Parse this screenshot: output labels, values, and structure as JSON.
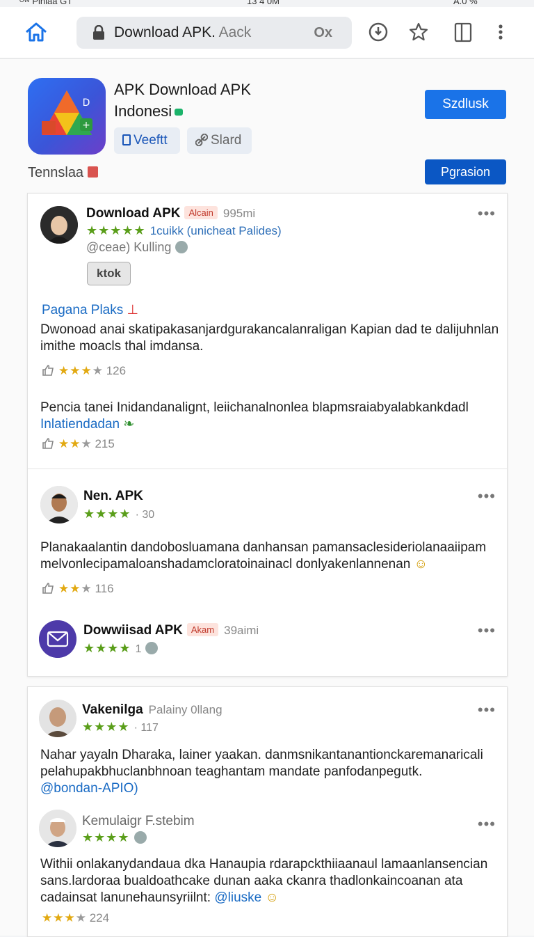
{
  "status_bar": {
    "left": "ᴼᵂ Pinlaa GT",
    "center": "13 4 0M",
    "right": "A.0 %"
  },
  "browser": {
    "url_main": "Download APK.",
    "url_dim": " Aack",
    "url_suffix": "Ox"
  },
  "app": {
    "title_line1": "APK Download APK",
    "title_line2": "Indonesi",
    "verify_chip": "Veeftt",
    "share_chip": "Slard",
    "primary_button": "Szdlusk",
    "secondary_button": "Pgrasion",
    "section_label": "Tennslaa"
  },
  "reviews": [
    {
      "name": "Download APK",
      "tag": "Alcain",
      "meta": "995mi",
      "stars_text": "★★★★★",
      "stars_label": "1cuikk (unicheat Palides)",
      "handle": "@ceae) Kulling",
      "button": "ktok",
      "link": "Pagana Plaks",
      "text": "Dwonoad anai skatipakasanjardgurakancalanraligan Kapian dad te dalijuhnlan imithe moacls thal imdansa.",
      "rating_stars": "★★★",
      "rating_empty": "★",
      "rating_count": "126",
      "text2": "Pencia tanei Inidandanalignt, leiichanalnonlea blapmsraiabyalabkankdadl",
      "text2_link": "Inlatiendadan",
      "rating2_stars": "★★",
      "rating2_empty": "★",
      "rating2_count": "215"
    },
    {
      "name": "Nen. APK",
      "stars_text": "★★★★",
      "stars_count": "· 30",
      "text": "Planakaalantin dandobosluamana danhansan pamansaclesideriolanaaiipam melvonlecipamaloanshadamcloratoinainacl donlyakenlannenan",
      "rating_stars": "★★",
      "rating_empty": "★",
      "rating_count": "116"
    },
    {
      "name": "Dowwiisad APK",
      "tag": "Akam",
      "meta": "39aimi",
      "stars_text": "★★★★",
      "stars_count": "1"
    },
    {
      "name": "Vakenilga",
      "meta": "Palainy 0llang",
      "stars_text": "★★★★",
      "stars_count": "· 117",
      "text": "Nahar yayaln Dharaka, lainer yaakan. danmsnikantanantionckaremanaricali pelahupakbhuclanbhnoan teaghantam mandate panfodanpegutk.",
      "text_link": "@bondan-APIO)"
    },
    {
      "name": "Kemulaigr F.stebim",
      "stars_text": "★★★★",
      "text": "Withii onlakanydandaua dka Hanaupia rdarapckthiiaanaul lamaanlansencian sans.lardoraa bualdoathcake dunan aaka ckanra thadlonkaincoanan ata cadainsat lanunehaunsyriilnt:",
      "text_link": "@liuske",
      "rating_stars": "★★★",
      "rating_empty": "★",
      "rating_count": "224"
    }
  ],
  "colors": {
    "accent": "#1a73e8",
    "star_green": "#4a9a1b",
    "star_gold": "#e2a911",
    "link": "#1a6bc4"
  }
}
